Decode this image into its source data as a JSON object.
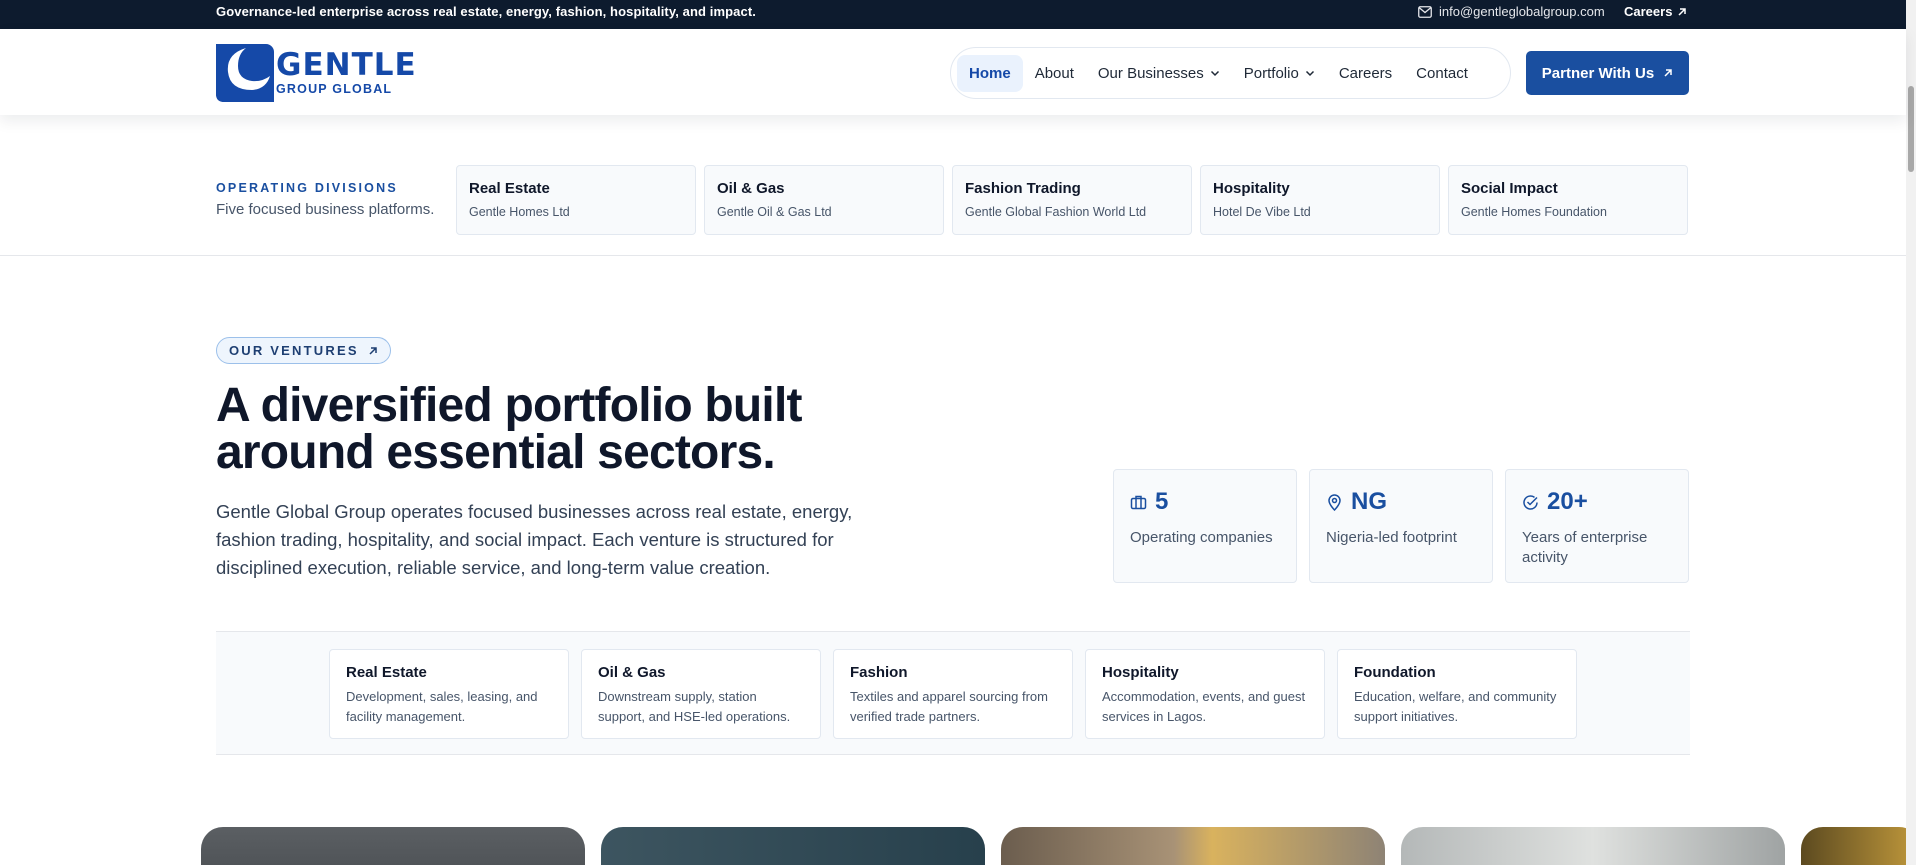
{
  "topbar": {
    "tagline": "Governance-led enterprise across real estate, energy, fashion, hospitality, and impact.",
    "email": "info@gentleglobalgroup.com",
    "careers_label": "Careers"
  },
  "brand": {
    "name_line1": "GENTLE",
    "name_line2": "GROUP GLOBAL",
    "color": "#1549a8"
  },
  "nav": {
    "items": [
      {
        "label": "Home",
        "active": true
      },
      {
        "label": "About"
      },
      {
        "label": "Our Businesses",
        "dropdown": true
      },
      {
        "label": "Portfolio",
        "dropdown": true
      },
      {
        "label": "Careers"
      },
      {
        "label": "Contact"
      }
    ],
    "cta_label": "Partner With Us"
  },
  "divisions": {
    "heading": "OPERATING DIVISIONS",
    "subheading": "Five focused business platforms.",
    "cards": [
      {
        "title": "Real Estate",
        "subtitle": "Gentle Homes Ltd"
      },
      {
        "title": "Oil & Gas",
        "subtitle": "Gentle Oil & Gas Ltd"
      },
      {
        "title": "Fashion Trading",
        "subtitle": "Gentle Global Fashion World Ltd"
      },
      {
        "title": "Hospitality",
        "subtitle": "Hotel De Vibe Ltd"
      },
      {
        "title": "Social Impact",
        "subtitle": "Gentle Homes Foundation"
      }
    ]
  },
  "ventures": {
    "badge": "OUR VENTURES",
    "headline": "A diversified portfolio built around essential sectors.",
    "lede": "Gentle Global Group operates focused businesses across real estate, energy, fashion trading, hospitality, and social impact. Each venture is structured for disciplined execution, reliable service, and long-term value creation.",
    "stats": [
      {
        "icon": "briefcase-icon",
        "value": "5",
        "label": "Operating companies"
      },
      {
        "icon": "map-pin-icon",
        "value": "NG",
        "label": "Nigeria-led footprint"
      },
      {
        "icon": "check-circle-icon",
        "value": "20+",
        "label": "Years of enterprise activity"
      }
    ],
    "businesses": [
      {
        "title": "Real Estate",
        "description": "Development, sales, leasing, and facility management."
      },
      {
        "title": "Oil & Gas",
        "description": "Downstream supply, station support, and HSE-led operations."
      },
      {
        "title": "Fashion",
        "description": "Textiles and apparel sourcing from verified trade partners."
      },
      {
        "title": "Hospitality",
        "description": "Accommodation, events, and guest services in Lagos."
      },
      {
        "title": "Foundation",
        "description": "Education, welfare, and community support initiatives."
      }
    ]
  },
  "colors": {
    "accent": "#1a4fa0",
    "topbar_bg": "#0d1b2e"
  }
}
